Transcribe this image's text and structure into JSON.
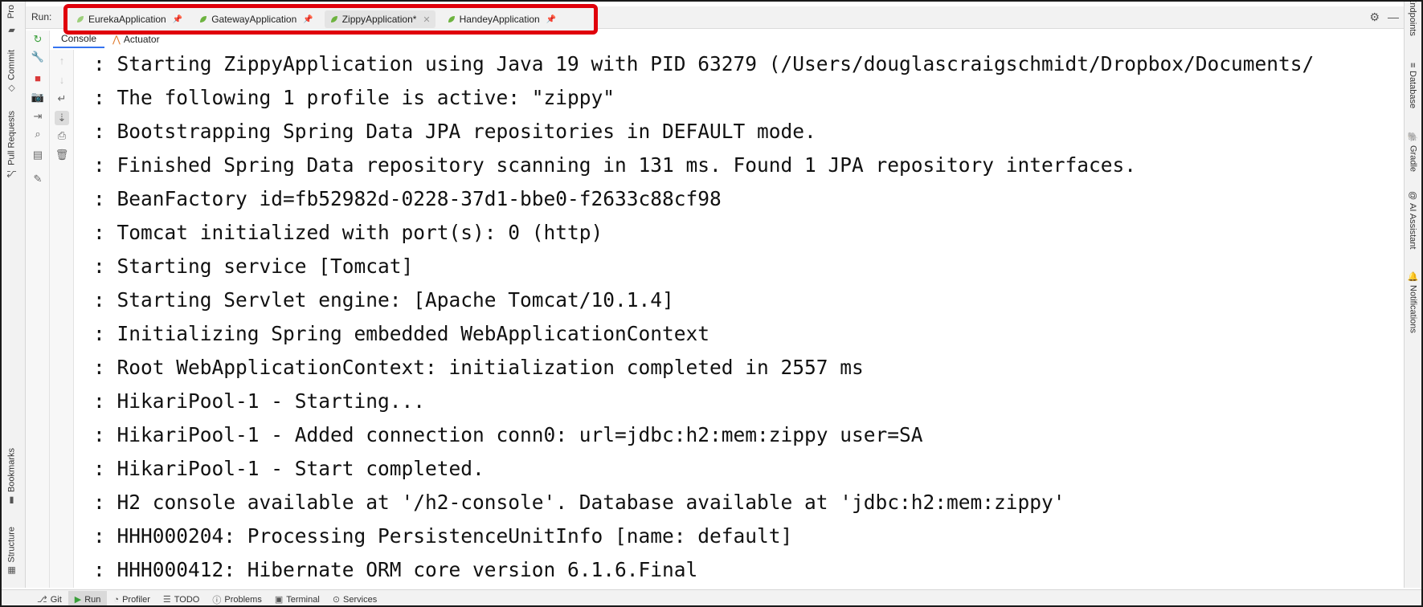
{
  "run_panel": {
    "label": "Run:",
    "tabs": [
      {
        "label": "EurekaApplication"
      },
      {
        "label": "GatewayApplication"
      },
      {
        "label": "ZippyApplication*"
      },
      {
        "label": "HandeyApplication"
      }
    ],
    "subtabs": [
      {
        "label": "Console"
      },
      {
        "label": "Actuator"
      }
    ]
  },
  "left_sidebar": {
    "items": [
      "Pro",
      "Commit",
      "Pull Requests",
      "Bookmarks",
      "Structure"
    ]
  },
  "right_sidebar": {
    "items": [
      "Endpoints",
      "Database",
      "Gradle",
      "AI Assistant",
      "Notifications"
    ]
  },
  "console": {
    "lines": [
      ": Starting ZippyApplication using Java 19 with PID 63279 (/Users/douglascraigschmidt/Dropbox/Documents/",
      ": The following 1 profile is active: \"zippy\"",
      ": Bootstrapping Spring Data JPA repositories in DEFAULT mode.",
      ": Finished Spring Data repository scanning in 131 ms. Found 1 JPA repository interfaces.",
      ": BeanFactory id=fb52982d-0228-37d1-bbe0-f2633c88cf98",
      ": Tomcat initialized with port(s): 0 (http)",
      ": Starting service [Tomcat]",
      ": Starting Servlet engine: [Apache Tomcat/10.1.4]",
      ": Initializing Spring embedded WebApplicationContext",
      ": Root WebApplicationContext: initialization completed in 2557 ms",
      ": HikariPool-1 - Starting...",
      ": HikariPool-1 - Added connection conn0: url=jdbc:h2:mem:zippy user=SA",
      ": HikariPool-1 - Start completed.",
      ": H2 console available at '/h2-console'. Database available at 'jdbc:h2:mem:zippy'",
      ": HHH000204: Processing PersistenceUnitInfo [name: default]",
      ": HHH000412: Hibernate ORM core version 6.1.6.Final"
    ]
  },
  "status_bar": {
    "items": [
      {
        "label": "Git",
        "icon": "git-branch-icon"
      },
      {
        "label": "Run",
        "icon": "run-icon"
      },
      {
        "label": "Profiler",
        "icon": "profiler-icon"
      },
      {
        "label": "TODO",
        "icon": "todo-icon"
      },
      {
        "label": "Problems",
        "icon": "problems-icon"
      },
      {
        "label": "Terminal",
        "icon": "terminal-icon"
      },
      {
        "label": "Services",
        "icon": "services-icon"
      }
    ]
  },
  "colors": {
    "highlight_border": "#e0000b",
    "spring_green": "#6db33f",
    "accent_blue": "#3574f0"
  }
}
